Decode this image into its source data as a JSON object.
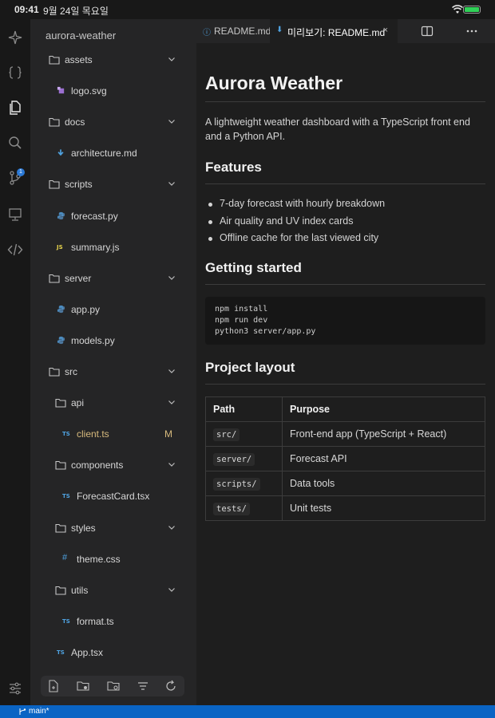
{
  "status": {
    "time": "09:41",
    "date": "9월 24일 목요일"
  },
  "sidebar": {
    "title": "aurora-weather",
    "tree": [
      {
        "label": "assets",
        "kind": "folder",
        "indent": 0
      },
      {
        "label": "logo.svg",
        "kind": "svg",
        "indent": 1
      },
      {
        "label": "docs",
        "kind": "folder",
        "indent": 0
      },
      {
        "label": "architecture.md",
        "kind": "md",
        "indent": 1
      },
      {
        "label": "scripts",
        "kind": "folder",
        "indent": 0
      },
      {
        "label": "forecast.py",
        "kind": "py",
        "indent": 1
      },
      {
        "label": "summary.js",
        "kind": "js",
        "indent": 1
      },
      {
        "label": "server",
        "kind": "folder",
        "indent": 0
      },
      {
        "label": "app.py",
        "kind": "py",
        "indent": 1
      },
      {
        "label": "models.py",
        "kind": "py",
        "indent": 1
      },
      {
        "label": "src",
        "kind": "folder",
        "indent": 0
      },
      {
        "label": "api",
        "kind": "folder",
        "indent": 1
      },
      {
        "label": "client.ts",
        "kind": "ts",
        "indent": 2,
        "modified": "M"
      },
      {
        "label": "components",
        "kind": "folder",
        "indent": 1
      },
      {
        "label": "ForecastCard.tsx",
        "kind": "ts",
        "indent": 2
      },
      {
        "label": "styles",
        "kind": "folder",
        "indent": 1
      },
      {
        "label": "theme.css",
        "kind": "css",
        "indent": 2
      },
      {
        "label": "utils",
        "kind": "folder",
        "indent": 1
      },
      {
        "label": "format.ts",
        "kind": "ts",
        "indent": 2
      },
      {
        "label": "App.tsx",
        "kind": "ts",
        "indent": 1
      }
    ]
  },
  "tabs": [
    {
      "label": "README.md",
      "icon": "info-icon"
    },
    {
      "label": "미리보기: README.md",
      "icon": "markdown-icon",
      "close": "×"
    }
  ],
  "readme": {
    "h1": "Aurora Weather",
    "intro": "A lightweight weather dashboard with a TypeScript front end and a Python API.",
    "features_heading": "Features",
    "features": [
      "7-day forecast with hourly breakdown",
      "Air quality and UV index cards",
      "Offline cache for the last viewed city"
    ],
    "getting_started_heading": "Getting started",
    "code_lines": [
      "npm install",
      "npm run dev",
      "python3 server/app.py"
    ],
    "layout_heading": "Project layout",
    "table_headers": [
      "Path",
      "Purpose"
    ],
    "table_rows": [
      [
        "src/",
        "Front-end app (TypeScript + React)"
      ],
      [
        "server/",
        "Forecast API"
      ],
      [
        "scripts/",
        "Data tools"
      ],
      [
        "tests/",
        "Unit tests"
      ]
    ]
  },
  "activity": {
    "source_control_badge": "1"
  },
  "bottom": {
    "branch": "main*"
  },
  "colors": {
    "accent": "#0a64c4",
    "modified": "#d7ba7d",
    "battery": "#30d158"
  }
}
